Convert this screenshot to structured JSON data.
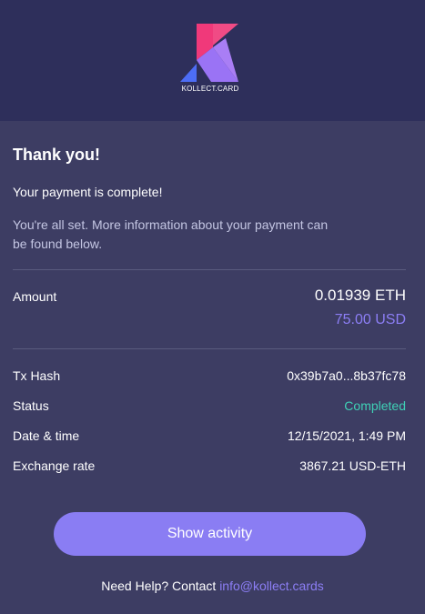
{
  "brand": {
    "logo_text": "KOLLECT.CARD",
    "colors": {
      "pink": "#f0397a",
      "purple": "#8e6cf2",
      "blue": "#5b6ff5"
    }
  },
  "message": {
    "title": "Thank you!",
    "subtitle": "Your payment is complete!",
    "info": "You're all set. More information about your payment can be found below."
  },
  "amount": {
    "label": "Amount",
    "eth": "0.01939 ETH",
    "usd": "75.00 USD"
  },
  "details": [
    {
      "label": "Tx Hash",
      "value": "0x39b7a0...8b37fc78"
    },
    {
      "label": "Status",
      "value": "Completed"
    },
    {
      "label": "Date & time",
      "value": "12/15/2021, 1:49 PM"
    },
    {
      "label": "Exchange rate",
      "value": "3867.21 USD-ETH"
    }
  ],
  "actions": {
    "show_activity": "Show activity"
  },
  "help": {
    "prefix": "Need Help? Contact",
    "email": "info@kollect.cards"
  },
  "colors": {
    "background": "#3d3d63",
    "header": "#2e2f5b",
    "accent": "#8a7df3",
    "success": "#3fd1b6"
  }
}
